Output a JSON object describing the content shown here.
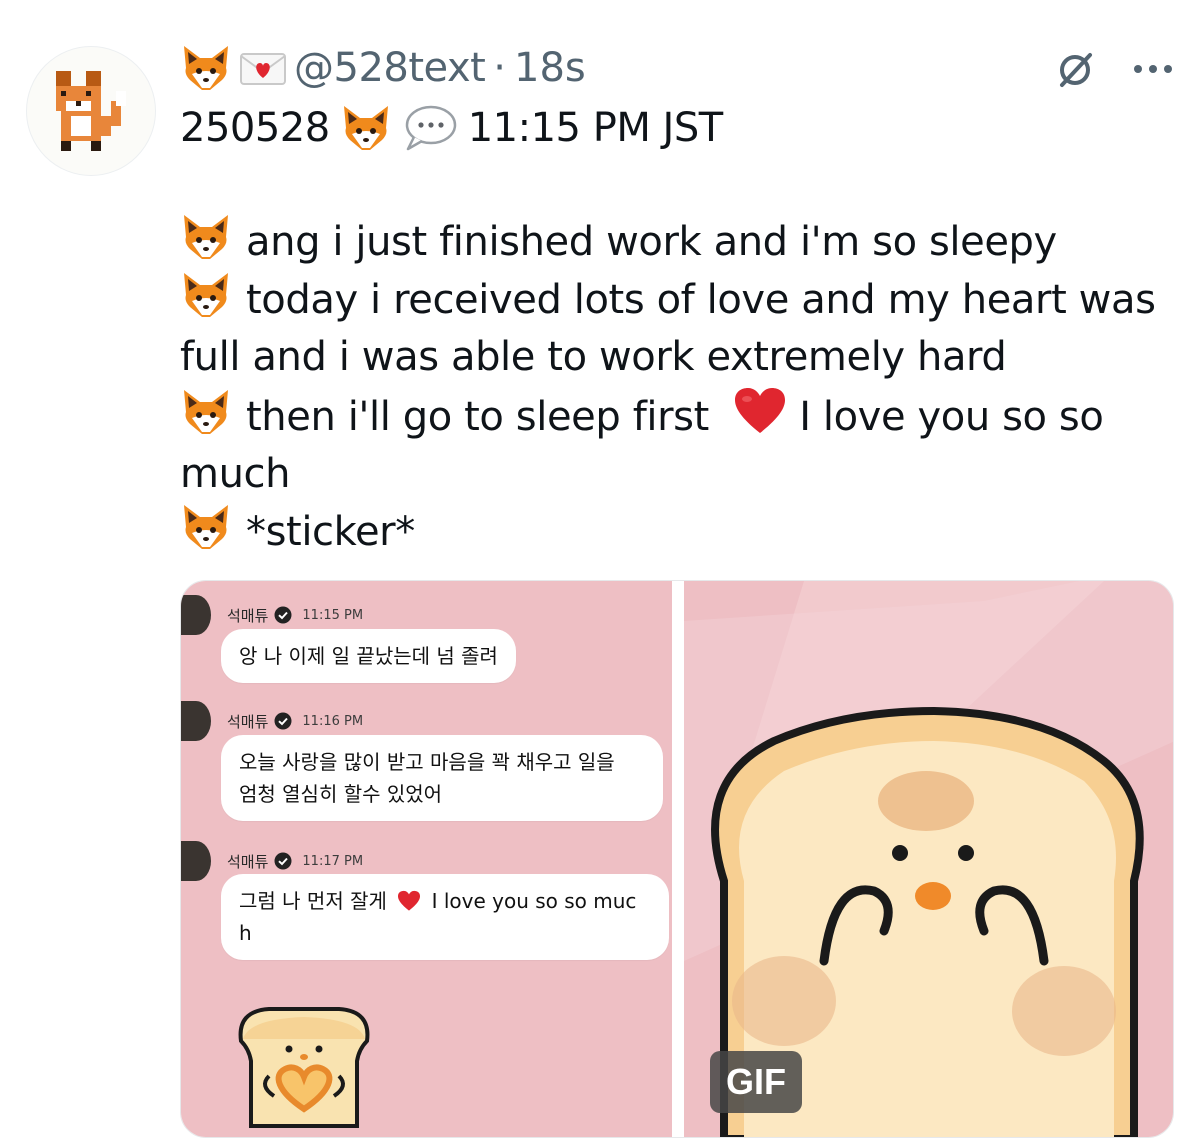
{
  "tweet": {
    "handle": "@528text",
    "separator": "·",
    "time_ago": "18s",
    "date_code": "250528",
    "time_label": "11:15 PM JST",
    "lines": [
      "ang i just finished work and i'm so sleepy",
      "today i received lots of love and my heart was",
      "full and i was able to work extremely hard",
      "then i'll go to sleep first",
      "I love you so so",
      "much",
      "*sticker*"
    ]
  },
  "media": {
    "messages": [
      {
        "name": "석매튜",
        "time": "11:15 PM",
        "text_1": "앙 나 이제 일 끝났는데 넘 졸려",
        "text_2": ""
      },
      {
        "name": "석매튜",
        "time": "11:16 PM",
        "text_1": "오늘 사랑을 많이 받고 마음을 꽉 채우고 일을",
        "text_2": "엄청 열심히 할수 있었어"
      },
      {
        "name": "석매튜",
        "time": "11:17 PM",
        "text_1": "그럼 나 먼저 잘게",
        "text_1b": "I love you so so muc",
        "text_2": "h"
      }
    ],
    "gif_label": "GIF"
  },
  "icons": {
    "fox": "fox-face-icon",
    "mail": "love-letter-icon",
    "speech": "speech-bubble-icon",
    "heart": "red-heart-icon",
    "grok": "grok-icon",
    "more": "more-icon",
    "verified": "verified-check-icon"
  },
  "colors": {
    "text": "#0f1419",
    "muted": "#536471",
    "panel_pink": "#eebfc4",
    "heart_red": "#e0262f",
    "fox_orange": "#f08a1c"
  }
}
